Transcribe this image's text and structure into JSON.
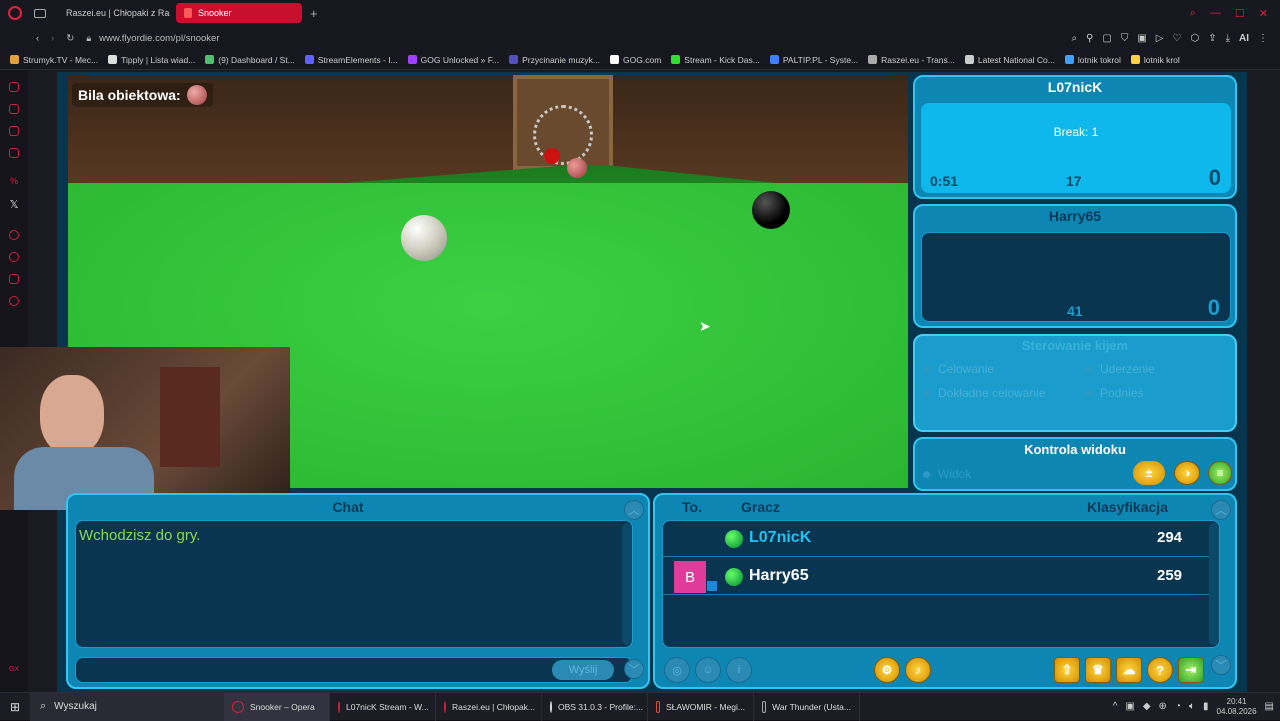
{
  "browser": {
    "tabs": [
      {
        "label": "Raszei.eu | Chłopaki z Ras",
        "active": false
      },
      {
        "label": "Snooker",
        "active": true
      }
    ],
    "new_tab": "+",
    "url": "www.flyordie.com/pl/snooker",
    "ai_label": "AI",
    "bookmarks": [
      {
        "label": "Strumyk.TV - Mec...",
        "color": "#e0a040"
      },
      {
        "label": "Tipply | Lista wiad...",
        "color": "#dddddd"
      },
      {
        "label": "(9) Dashboard / St...",
        "color": "#50c070"
      },
      {
        "label": "StreamElements - I...",
        "color": "#6060ff"
      },
      {
        "label": "GOG Unlocked » F...",
        "color": "#a040ff"
      },
      {
        "label": "Przycinanie muzyk...",
        "color": "#5050c0"
      },
      {
        "label": "GOG.com",
        "color": "#ffffff"
      },
      {
        "label": "Stream - Kick Das...",
        "color": "#30e030"
      },
      {
        "label": "PALTIP.PL - Syste...",
        "color": "#4080ff"
      },
      {
        "label": "Raszei.eu - Trans...",
        "color": "#aaaaaa"
      },
      {
        "label": "Latest National Co...",
        "color": "#cccccc"
      },
      {
        "label": "lotnik tokrol",
        "color": "#40a0ff"
      },
      {
        "label": "lotnik krol",
        "color": "#ffd040"
      }
    ]
  },
  "game": {
    "object_ball_label": "Bila obiektowa:",
    "players": [
      {
        "name": "L07nicK",
        "break_label": "Break: 1",
        "timer": "0:51",
        "frame_points": "17",
        "frames": "0"
      },
      {
        "name": "Harry65",
        "break_label": "",
        "timer": "",
        "frame_points": "41",
        "frames": "0"
      }
    ],
    "cue_control": {
      "title": "Sterowanie kijem",
      "options": [
        "Celowanie",
        "Uderzenie",
        "Dokładne celowanie",
        "Podnieś"
      ]
    },
    "view_control": {
      "title": "Kontrola widoku",
      "option": "Widok"
    },
    "chat": {
      "title": "Chat",
      "messages": [
        "Wchodzisz do gry."
      ],
      "send_label": "Wyślij"
    },
    "ranking": {
      "col_to": "To.",
      "col_player": "Gracz",
      "col_rating": "Klasyfikacja",
      "rows": [
        {
          "badge": "",
          "name": "L07nicK",
          "rating": "294",
          "highlight": true
        },
        {
          "badge": "B",
          "name": "Harry65",
          "rating": "259",
          "highlight": false
        }
      ]
    }
  },
  "taskbar": {
    "search_placeholder": "Wyszukaj",
    "items": [
      "Snooker – Opera",
      "L07nicK Stream - W...",
      "Raszei.eu | Chłopak...",
      "OBS 31.0.3 - Profile:...",
      "SŁAWOMIR - Megi...",
      "War Thunder (Usta..."
    ],
    "time": "20:41",
    "date": "04.08.2026"
  }
}
